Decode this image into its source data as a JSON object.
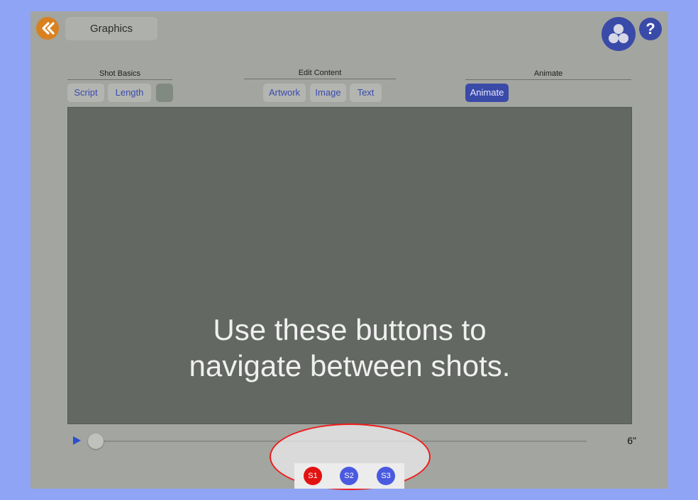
{
  "header": {
    "title": "Graphics",
    "back_icon": "double-chevron-left-icon",
    "group_icon": "three-circles-icon",
    "help_label": "?"
  },
  "sections": {
    "shot_basics": "Shot Basics",
    "edit_content": "Edit Content",
    "animate": "Animate"
  },
  "buttons": {
    "script": "Script",
    "length": "Length",
    "artwork": "Artwork",
    "image": "Image",
    "text": "Text",
    "animate": "Animate"
  },
  "overlay": {
    "line1": "Use these buttons to",
    "line2": "navigate between shots."
  },
  "timeline": {
    "duration": "6\"",
    "progress_percent": 0
  },
  "shots": [
    {
      "label": "S1",
      "selected": true
    },
    {
      "label": "S2",
      "selected": false
    },
    {
      "label": "S3",
      "selected": false
    }
  ],
  "colors": {
    "accent": "#3a4aa8",
    "back": "#d9811f",
    "selected_shot": "#e21212",
    "shot": "#4a5ae0",
    "highlight": "#ee1c1c"
  }
}
